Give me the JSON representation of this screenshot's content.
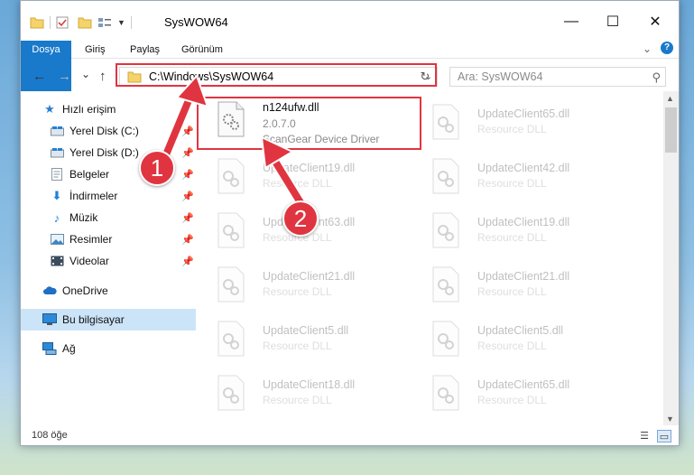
{
  "window": {
    "title": "SysWOW64",
    "controls": {
      "minimize": "—",
      "maximize": "☐",
      "close": "✕"
    }
  },
  "ribbon": {
    "tabs": [
      "Dosya",
      "Giriş",
      "Paylaş",
      "Görünüm"
    ]
  },
  "navigation": {
    "back": "←",
    "forward": "→",
    "recent": "⌄",
    "up": "↑",
    "address": "C:\\Windows\\SysWOW64",
    "refresh": "↻",
    "search_placeholder": "Ara: SysWOW64"
  },
  "sidebar": {
    "items": [
      {
        "label": "Hızlı erişim",
        "icon": "star-icon",
        "pinned": false
      },
      {
        "label": "Yerel Disk (C:)",
        "icon": "drive-icon",
        "pinned": true
      },
      {
        "label": "Yerel Disk (D:)",
        "icon": "drive-icon",
        "pinned": true
      },
      {
        "label": "Belgeler",
        "icon": "documents-icon",
        "pinned": true
      },
      {
        "label": "İndirmeler",
        "icon": "download-icon",
        "pinned": true
      },
      {
        "label": "Müzik",
        "icon": "music-icon",
        "pinned": true
      },
      {
        "label": "Resimler",
        "icon": "pictures-icon",
        "pinned": true
      },
      {
        "label": "Videolar",
        "icon": "videos-icon",
        "pinned": true
      },
      {
        "label": "OneDrive",
        "icon": "cloud-icon",
        "pinned": false
      },
      {
        "label": "Bu bilgisayar",
        "icon": "computer-icon",
        "pinned": false,
        "selected": true
      },
      {
        "label": "Ağ",
        "icon": "network-icon",
        "pinned": false
      }
    ]
  },
  "files": {
    "highlighted": {
      "name": "n124ufw.dll",
      "version": "2.0.7.0",
      "description": "ScanGear Device Driver"
    },
    "left_column": [
      {
        "name": "UpdateClient19.dll",
        "type": "Resource DLL"
      },
      {
        "name": "UpdateClient63.dll",
        "type": "Resource DLL"
      },
      {
        "name": "UpdateClient21.dll",
        "type": "Resource DLL"
      },
      {
        "name": "UpdateClient5.dll",
        "type": "Resource DLL"
      },
      {
        "name": "UpdateClient18.dll",
        "type": "Resource DLL"
      }
    ],
    "right_column": [
      {
        "name": "UpdateClient65.dll",
        "type": "Resource DLL"
      },
      {
        "name": "UpdateClient42.dll",
        "type": "Resource DLL"
      },
      {
        "name": "UpdateClient19.dll",
        "type": "Resource DLL"
      },
      {
        "name": "UpdateClient21.dll",
        "type": "Resource DLL"
      },
      {
        "name": "UpdateClient5.dll",
        "type": "Resource DLL"
      },
      {
        "name": "UpdateClient65.dll",
        "type": "Resource DLL"
      }
    ]
  },
  "status": {
    "item_count": "108 öğe"
  },
  "annotations": {
    "step1": "1",
    "step2": "2",
    "color": "#e03540"
  }
}
